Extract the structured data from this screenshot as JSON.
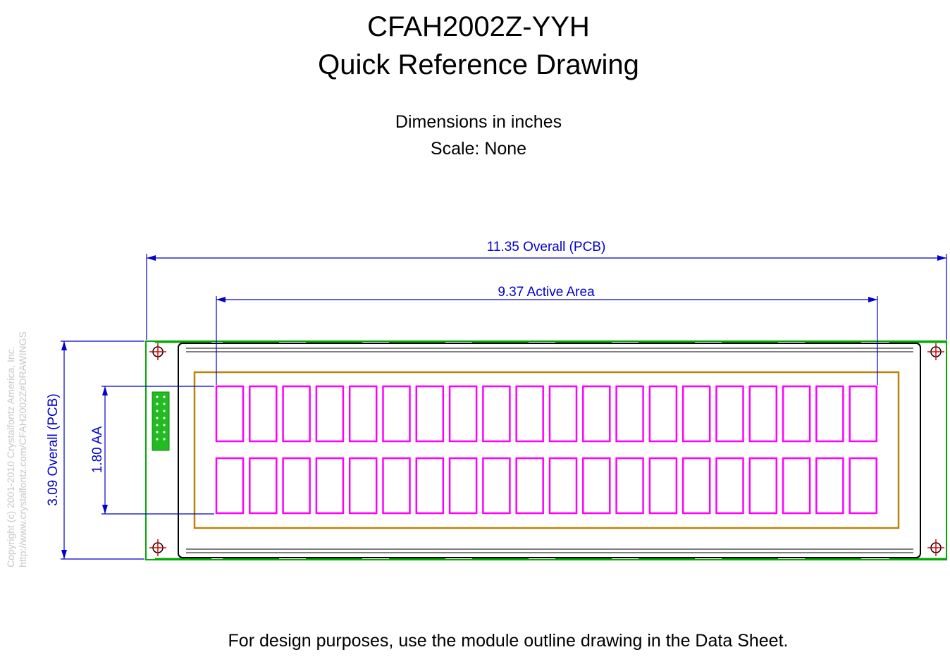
{
  "title": {
    "line1": "CFAH2002Z-YYH",
    "line2": "Quick Reference Drawing"
  },
  "subtitle": {
    "line1": "Dimensions in inches",
    "line2": "Scale: None"
  },
  "dimensions": {
    "overall_width": "11.35 Overall (PCB)",
    "active_width": "9.37 Active Area",
    "overall_height": "3.09 Overall (PCB)",
    "active_height": "1.80 AA"
  },
  "copyright": {
    "line1": "Copyright (c) 2001-2010 Crystalfontz America, Inc.",
    "line2": "http://www.crystalfontz.com/CFAH2002Z#DRAWINGS"
  },
  "footer": "For design purposes, use the module outline drawing in the Data Sheet.",
  "display": {
    "rows": 2,
    "columns": 20
  },
  "colors": {
    "dimension": "#0000cc",
    "pcb": "#00aa00",
    "bezel_outline": "#000000",
    "viewing_area": "#b8860b",
    "character_cells": "#ff00ff",
    "mounting_holes": "#dd0000",
    "connector": "#22bb22"
  }
}
